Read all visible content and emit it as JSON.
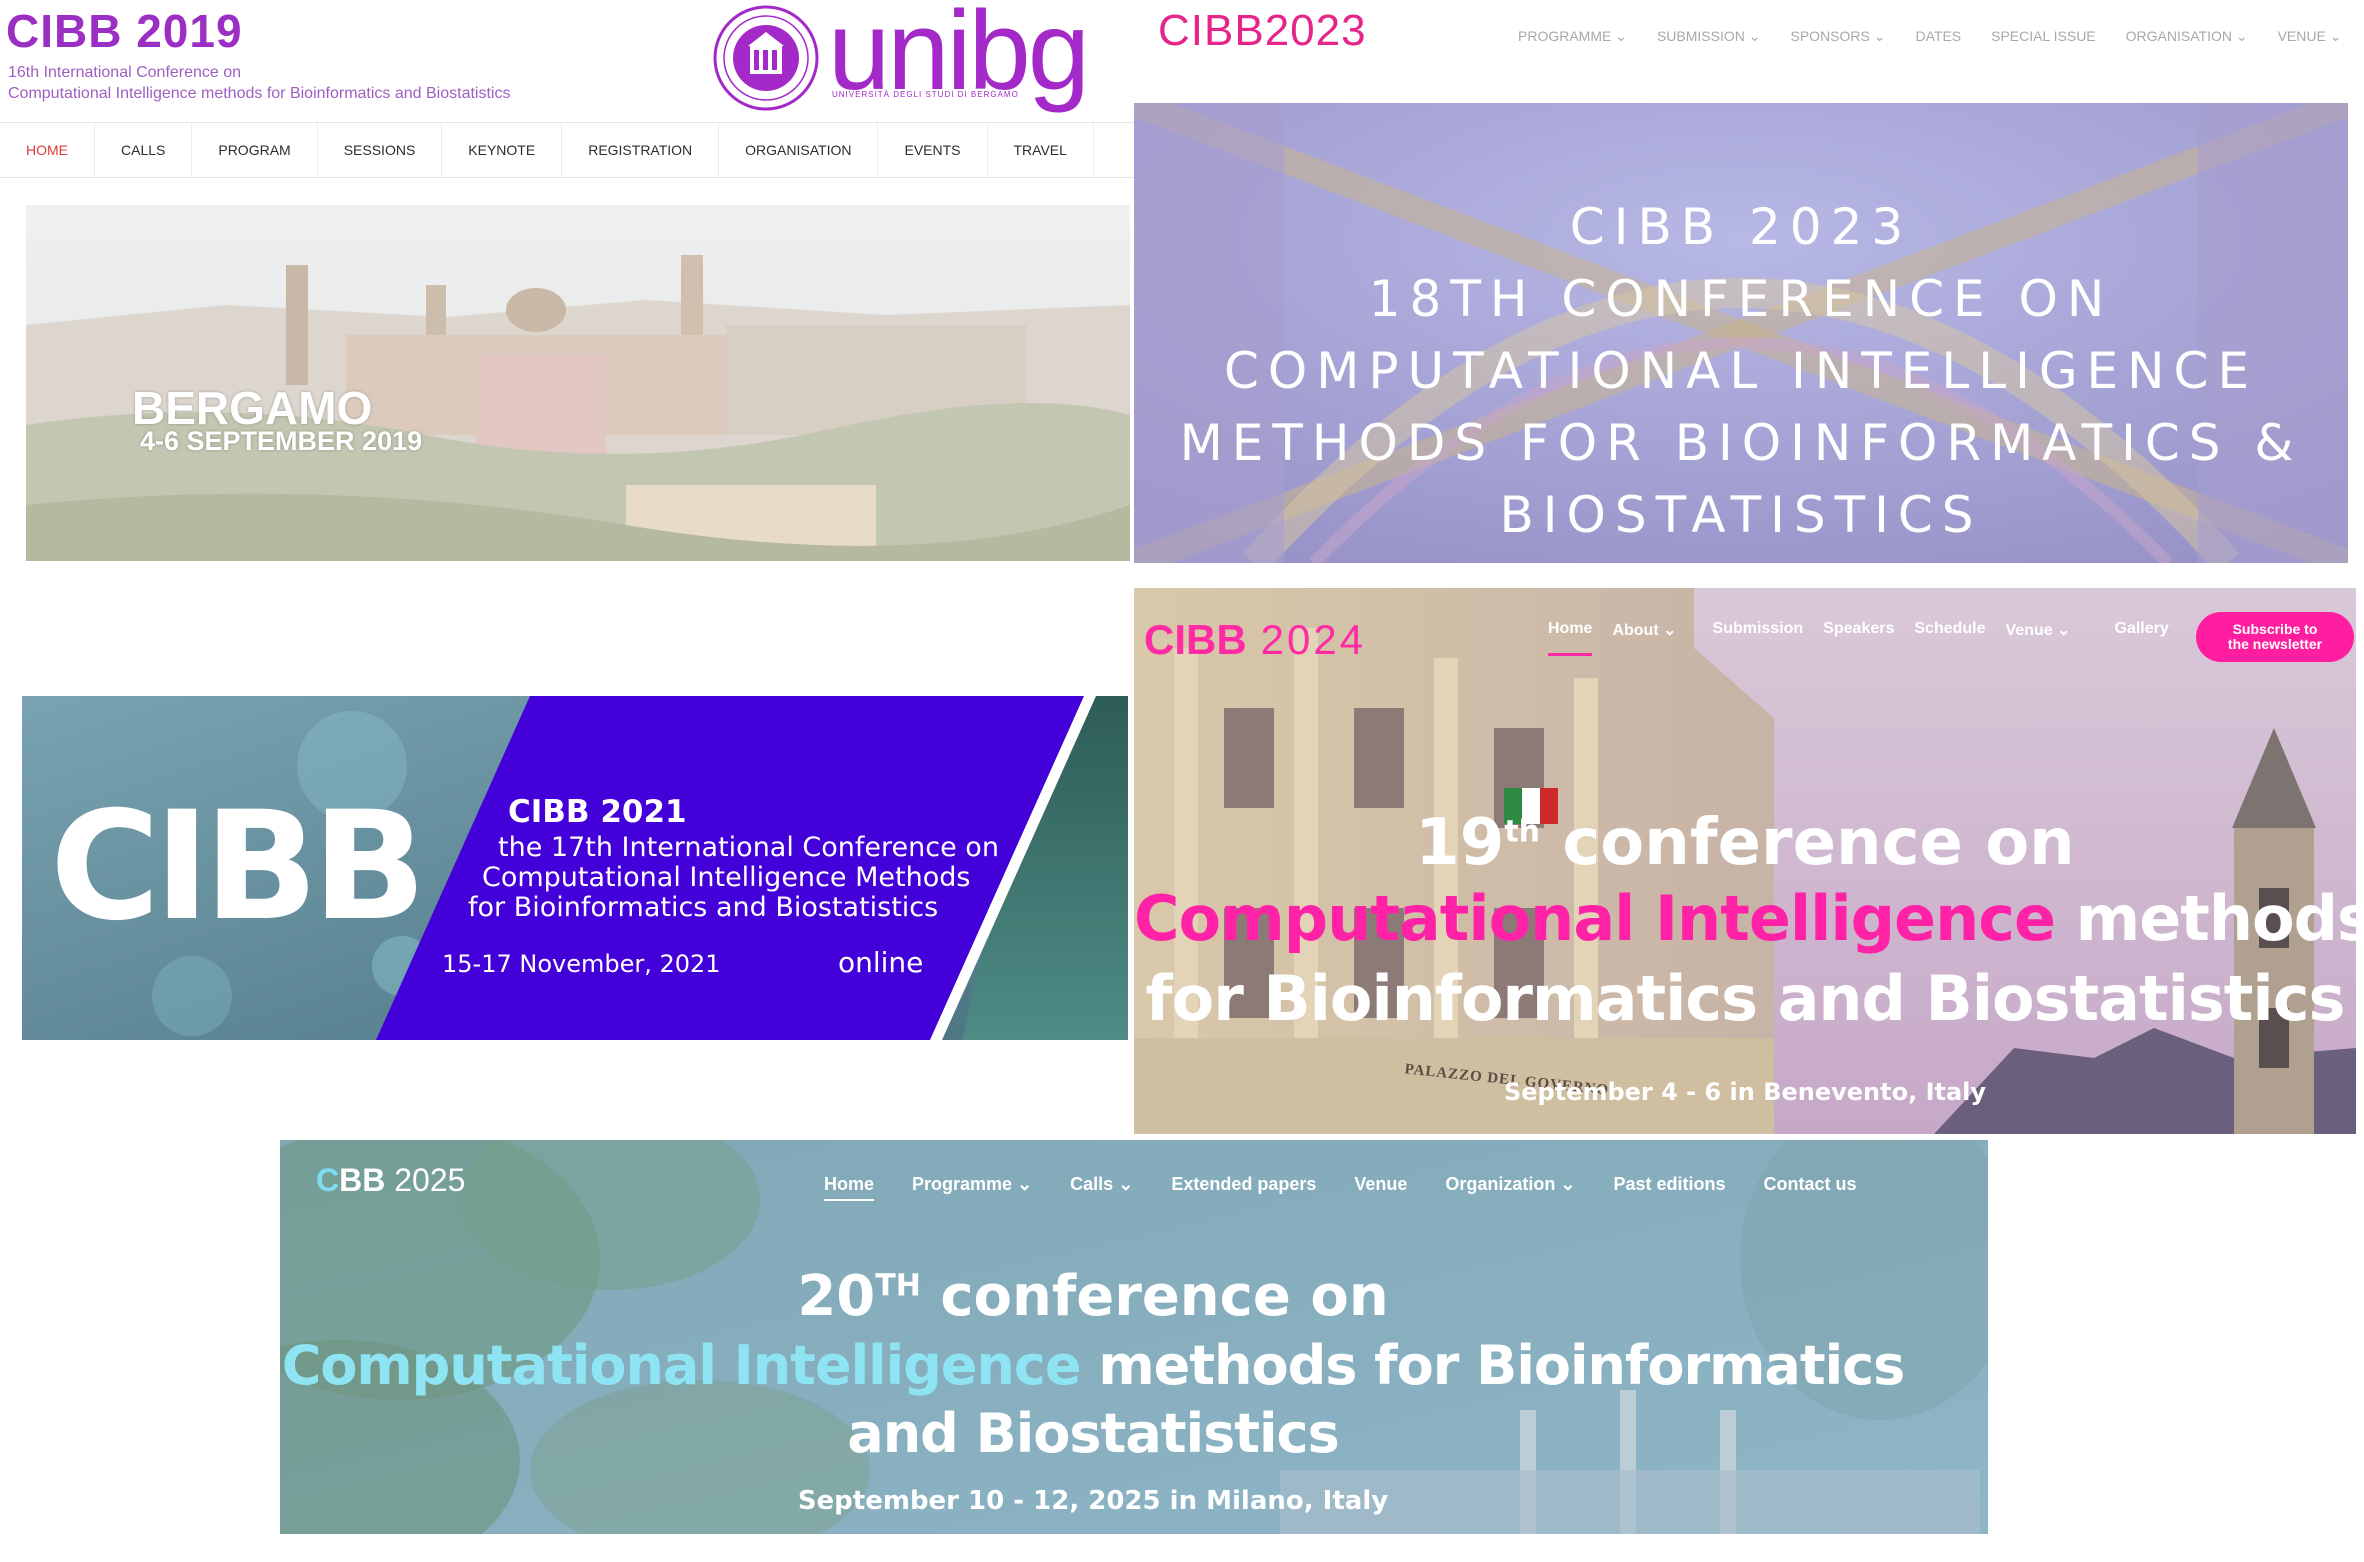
{
  "cibb2019": {
    "title": "CIBB 2019",
    "subtitle_line1": "16th International Conference on",
    "subtitle_line2": "Computational Intelligence methods for Bioinformatics and Biostatistics",
    "logo_word": "unibg",
    "logo_tagline": "UNIVERSITÀ DEGLI STUDI DI BERGAMO",
    "nav": [
      "HOME",
      "CALLS",
      "PROGRAM",
      "SESSIONS",
      "KEYNOTE",
      "REGISTRATION",
      "ORGANISATION",
      "EVENTS",
      "TRAVEL"
    ],
    "hero_city": "BERGAMO",
    "hero_dates": "4-6 SEPTEMBER 2019"
  },
  "cibb2023": {
    "logo": "CIBB2023",
    "nav": [
      "PROGRAMME",
      "SUBMISSION",
      "SPONSORS",
      "DATES",
      "SPECIAL ISSUE",
      "ORGANISATION",
      "VENUE"
    ],
    "hero_lines": [
      "CIBB 2023",
      "18TH CONFERENCE ON",
      "COMPUTATIONAL INTELLIGENCE",
      "METHODS FOR BIOINFORMATICS &",
      "BIOSTATISTICS"
    ]
  },
  "cibb2021": {
    "logo": "CIBB",
    "title": "CIBB 2021",
    "line1": "the 17th International Conference on",
    "line2": "Computational Intelligence Methods",
    "line3": "for Bioinformatics and Biostatistics",
    "dates": "15-17 November, 2021",
    "mode": "online"
  },
  "cibb2024": {
    "logo": "CIBB",
    "logo_year": "2024",
    "nav": [
      "Home",
      "About",
      "Submission",
      "Speakers",
      "Schedule",
      "Venue",
      "Gallery"
    ],
    "subscribe_line1": "Subscribe to",
    "subscribe_line2": "the newsletter",
    "ordinal_num": "19",
    "ordinal_sup": "th",
    "heading_rest": " conference on",
    "highlight": "Computational Intelligence",
    "heading_line2_rest": " methods",
    "heading_line3": "for Bioinformatics and Biostatistics",
    "dates": "September 4 - 6 in Benevento, Italy",
    "building_sign": "PALAZZO DEL GOVERNO"
  },
  "cibb2025": {
    "logo_c": "C",
    "logo_rest": "BB",
    "logo_year": "2025",
    "nav": [
      "Home",
      "Programme",
      "Calls",
      "Extended papers",
      "Venue",
      "Organization",
      "Past editions",
      "Contact us"
    ],
    "ordinal_num": "20",
    "ordinal_sup": "TH",
    "heading_rest": " conference on",
    "highlight": "Computational Intelligence",
    "heading_line2_rest": " methods for Bioinformatics",
    "heading_line3": "and Biostatistics",
    "dates": "September 10 - 12, 2025 in Milano, Italy"
  },
  "colors": {
    "purple_2019": "#9b2fc4",
    "pink_2023": "#e5258a",
    "blue_2021": "#4300d9",
    "magenta_2024": "#ff22a6",
    "cyan_2025": "#8fe4f4"
  }
}
